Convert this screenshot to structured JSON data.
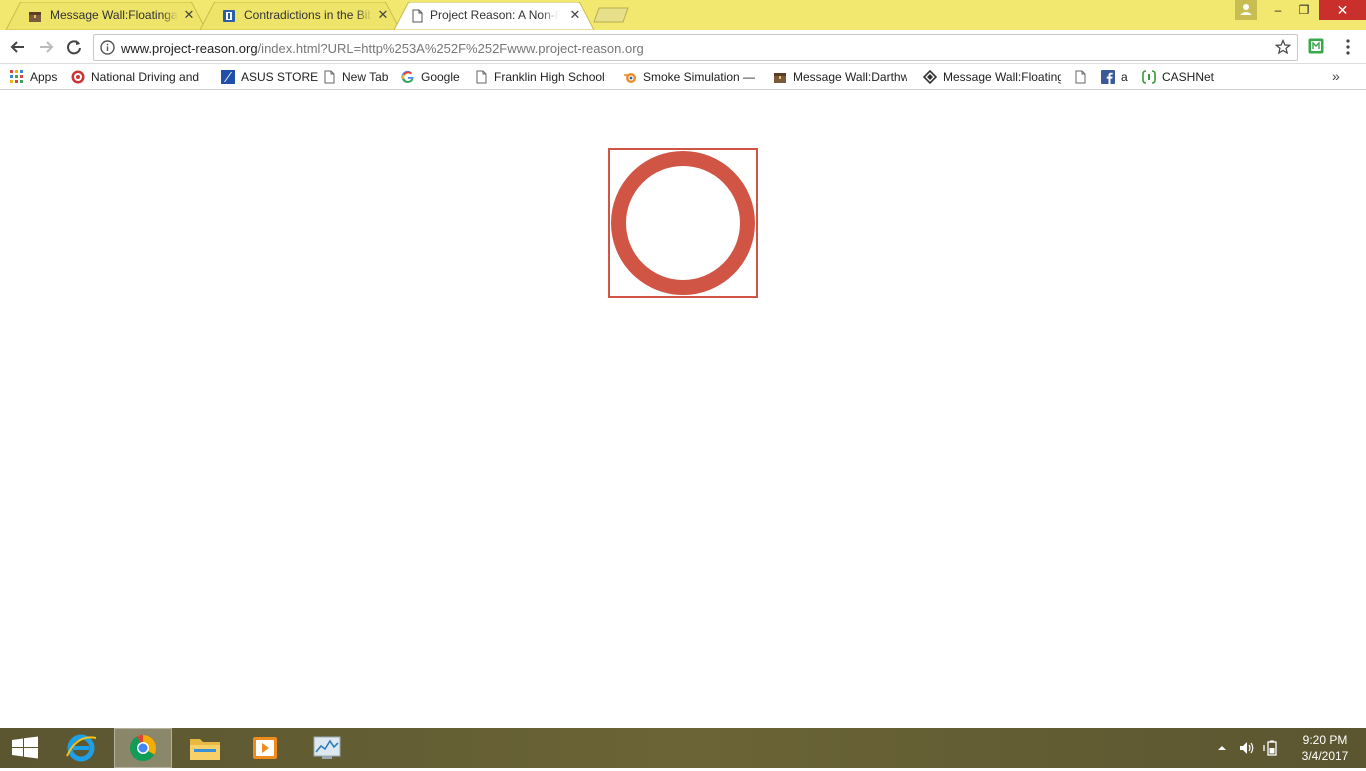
{
  "browser": {
    "tabs": [
      {
        "title": "Message Wall:Floatingax",
        "icon": "wiki-chest-icon",
        "active": false
      },
      {
        "title": "Contradictions in the Bib",
        "icon": "book-icon",
        "active": false
      },
      {
        "title": "Project Reason: A Non-P",
        "icon": "page-icon",
        "active": true
      }
    ],
    "tab_close_glyph": "✕",
    "address_bar": {
      "host": "www.project-reason.org",
      "path": "/index.html?URL=http%253A%252F%252Fwww.project-reason.org"
    },
    "bookmarks": [
      {
        "label": "Apps",
        "icon": "apps-grid-icon"
      },
      {
        "label": "National Driving and ",
        "icon": "national-driving-icon"
      },
      {
        "label": "ASUS STORE",
        "icon": "asus-icon"
      },
      {
        "label": "New Tab",
        "icon": "page-icon"
      },
      {
        "label": "Google",
        "icon": "google-icon"
      },
      {
        "label": "Franklin High School:",
        "icon": "page-icon"
      },
      {
        "label": "Smoke Simulation —",
        "icon": "blender-icon"
      },
      {
        "label": "Message Wall:Darthw",
        "icon": "wiki-chest-icon"
      },
      {
        "label": "Message Wall:Floating",
        "icon": "wiki-diamond-icon"
      },
      {
        "label": "",
        "icon": "page-icon"
      },
      {
        "label": "a",
        "icon": "facebook-icon"
      },
      {
        "label": "CASHNet",
        "icon": "cashnet-icon"
      }
    ],
    "bookmarks_overflow": "»",
    "window_controls": {
      "minimize": "–",
      "restore": "❐",
      "close": "✕"
    }
  },
  "page": {
    "loader": {
      "shape": "ring",
      "color": "#d05545"
    }
  },
  "taskbar": {
    "apps": [
      {
        "name": "start",
        "icon": "windows-start-icon"
      },
      {
        "name": "internet-explorer",
        "icon": "internet-explorer-icon"
      },
      {
        "name": "chrome",
        "icon": "chrome-icon",
        "active": true
      },
      {
        "name": "file-explorer",
        "icon": "folder-icon"
      },
      {
        "name": "media-player",
        "icon": "media-player-icon"
      },
      {
        "name": "resource-monitor",
        "icon": "monitor-icon"
      }
    ],
    "clock": {
      "time": "9:20 PM",
      "date": "3/4/2017"
    }
  },
  "colors": {
    "tabstrip": "#f2e870",
    "accent_red": "#d05545",
    "taskbar": "#5f5a33"
  }
}
